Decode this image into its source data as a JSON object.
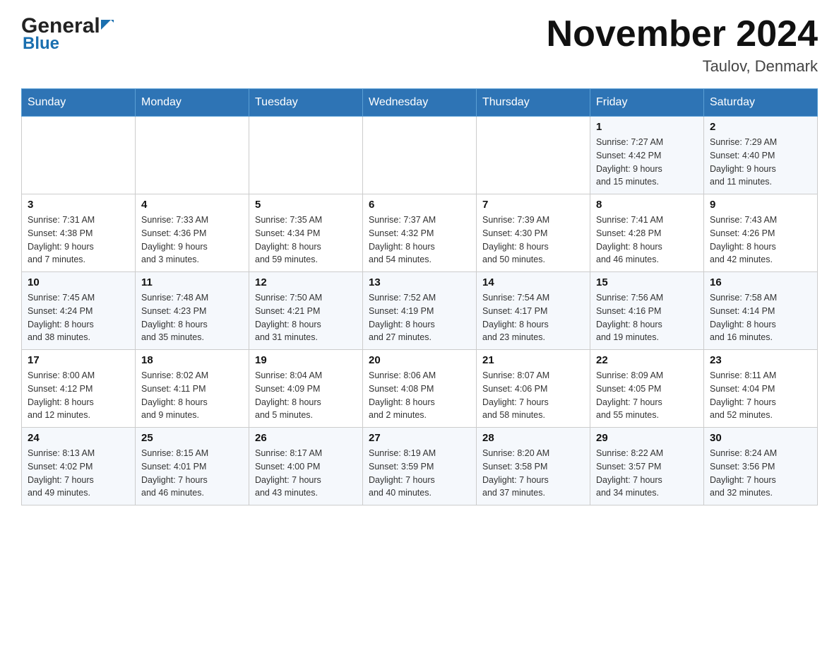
{
  "header": {
    "logo_general": "General",
    "logo_blue": "Blue",
    "month_title": "November 2024",
    "location": "Taulov, Denmark"
  },
  "weekdays": [
    "Sunday",
    "Monday",
    "Tuesday",
    "Wednesday",
    "Thursday",
    "Friday",
    "Saturday"
  ],
  "weeks": [
    [
      {
        "day": "",
        "info": ""
      },
      {
        "day": "",
        "info": ""
      },
      {
        "day": "",
        "info": ""
      },
      {
        "day": "",
        "info": ""
      },
      {
        "day": "",
        "info": ""
      },
      {
        "day": "1",
        "info": "Sunrise: 7:27 AM\nSunset: 4:42 PM\nDaylight: 9 hours\nand 15 minutes."
      },
      {
        "day": "2",
        "info": "Sunrise: 7:29 AM\nSunset: 4:40 PM\nDaylight: 9 hours\nand 11 minutes."
      }
    ],
    [
      {
        "day": "3",
        "info": "Sunrise: 7:31 AM\nSunset: 4:38 PM\nDaylight: 9 hours\nand 7 minutes."
      },
      {
        "day": "4",
        "info": "Sunrise: 7:33 AM\nSunset: 4:36 PM\nDaylight: 9 hours\nand 3 minutes."
      },
      {
        "day": "5",
        "info": "Sunrise: 7:35 AM\nSunset: 4:34 PM\nDaylight: 8 hours\nand 59 minutes."
      },
      {
        "day": "6",
        "info": "Sunrise: 7:37 AM\nSunset: 4:32 PM\nDaylight: 8 hours\nand 54 minutes."
      },
      {
        "day": "7",
        "info": "Sunrise: 7:39 AM\nSunset: 4:30 PM\nDaylight: 8 hours\nand 50 minutes."
      },
      {
        "day": "8",
        "info": "Sunrise: 7:41 AM\nSunset: 4:28 PM\nDaylight: 8 hours\nand 46 minutes."
      },
      {
        "day": "9",
        "info": "Sunrise: 7:43 AM\nSunset: 4:26 PM\nDaylight: 8 hours\nand 42 minutes."
      }
    ],
    [
      {
        "day": "10",
        "info": "Sunrise: 7:45 AM\nSunset: 4:24 PM\nDaylight: 8 hours\nand 38 minutes."
      },
      {
        "day": "11",
        "info": "Sunrise: 7:48 AM\nSunset: 4:23 PM\nDaylight: 8 hours\nand 35 minutes."
      },
      {
        "day": "12",
        "info": "Sunrise: 7:50 AM\nSunset: 4:21 PM\nDaylight: 8 hours\nand 31 minutes."
      },
      {
        "day": "13",
        "info": "Sunrise: 7:52 AM\nSunset: 4:19 PM\nDaylight: 8 hours\nand 27 minutes."
      },
      {
        "day": "14",
        "info": "Sunrise: 7:54 AM\nSunset: 4:17 PM\nDaylight: 8 hours\nand 23 minutes."
      },
      {
        "day": "15",
        "info": "Sunrise: 7:56 AM\nSunset: 4:16 PM\nDaylight: 8 hours\nand 19 minutes."
      },
      {
        "day": "16",
        "info": "Sunrise: 7:58 AM\nSunset: 4:14 PM\nDaylight: 8 hours\nand 16 minutes."
      }
    ],
    [
      {
        "day": "17",
        "info": "Sunrise: 8:00 AM\nSunset: 4:12 PM\nDaylight: 8 hours\nand 12 minutes."
      },
      {
        "day": "18",
        "info": "Sunrise: 8:02 AM\nSunset: 4:11 PM\nDaylight: 8 hours\nand 9 minutes."
      },
      {
        "day": "19",
        "info": "Sunrise: 8:04 AM\nSunset: 4:09 PM\nDaylight: 8 hours\nand 5 minutes."
      },
      {
        "day": "20",
        "info": "Sunrise: 8:06 AM\nSunset: 4:08 PM\nDaylight: 8 hours\nand 2 minutes."
      },
      {
        "day": "21",
        "info": "Sunrise: 8:07 AM\nSunset: 4:06 PM\nDaylight: 7 hours\nand 58 minutes."
      },
      {
        "day": "22",
        "info": "Sunrise: 8:09 AM\nSunset: 4:05 PM\nDaylight: 7 hours\nand 55 minutes."
      },
      {
        "day": "23",
        "info": "Sunrise: 8:11 AM\nSunset: 4:04 PM\nDaylight: 7 hours\nand 52 minutes."
      }
    ],
    [
      {
        "day": "24",
        "info": "Sunrise: 8:13 AM\nSunset: 4:02 PM\nDaylight: 7 hours\nand 49 minutes."
      },
      {
        "day": "25",
        "info": "Sunrise: 8:15 AM\nSunset: 4:01 PM\nDaylight: 7 hours\nand 46 minutes."
      },
      {
        "day": "26",
        "info": "Sunrise: 8:17 AM\nSunset: 4:00 PM\nDaylight: 7 hours\nand 43 minutes."
      },
      {
        "day": "27",
        "info": "Sunrise: 8:19 AM\nSunset: 3:59 PM\nDaylight: 7 hours\nand 40 minutes."
      },
      {
        "day": "28",
        "info": "Sunrise: 8:20 AM\nSunset: 3:58 PM\nDaylight: 7 hours\nand 37 minutes."
      },
      {
        "day": "29",
        "info": "Sunrise: 8:22 AM\nSunset: 3:57 PM\nDaylight: 7 hours\nand 34 minutes."
      },
      {
        "day": "30",
        "info": "Sunrise: 8:24 AM\nSunset: 3:56 PM\nDaylight: 7 hours\nand 32 minutes."
      }
    ]
  ]
}
